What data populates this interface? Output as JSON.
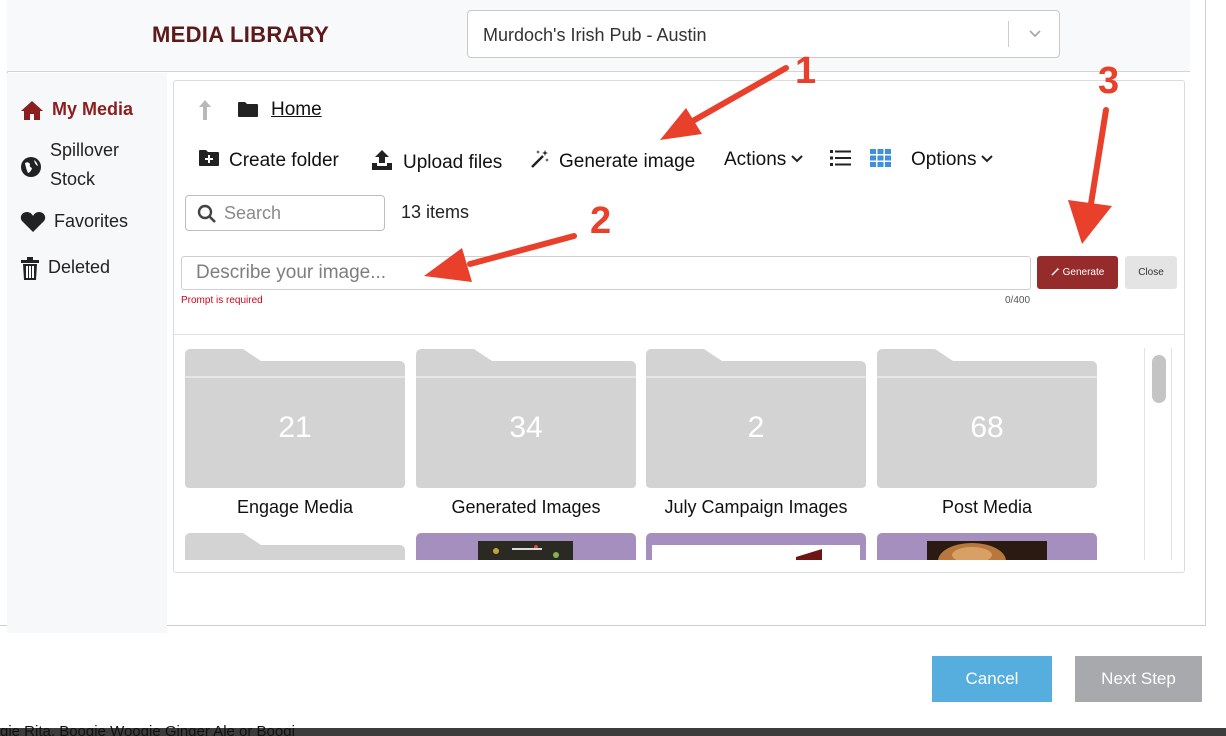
{
  "header": {
    "title": "MEDIA LIBRARY",
    "location_select": {
      "value": "Murdoch's Irish Pub - Austin"
    }
  },
  "sidebar": {
    "items": [
      {
        "label": "My Media",
        "icon": "home-icon",
        "active": true
      },
      {
        "label": "Spillover Stock",
        "icon": "globe-icon",
        "active": false
      },
      {
        "label": "Favorites",
        "icon": "heart-icon",
        "active": false
      },
      {
        "label": "Deleted",
        "icon": "trash-icon",
        "active": false
      }
    ]
  },
  "breadcrumb": {
    "home": "Home"
  },
  "toolbar": {
    "create_folder": "Create folder",
    "upload_files": "Upload files",
    "generate_image": "Generate image",
    "actions": "Actions",
    "options": "Options"
  },
  "search": {
    "placeholder": "Search",
    "item_count": "13 items"
  },
  "generate_panel": {
    "placeholder": "Describe your image...",
    "error": "Prompt is required",
    "char_count": "0/400",
    "generate_label": "Generate",
    "close_label": "Close"
  },
  "folders": [
    {
      "name": "Engage Media",
      "count": "21"
    },
    {
      "name": "Generated Images",
      "count": "34"
    },
    {
      "name": "July Campaign Images",
      "count": "2"
    },
    {
      "name": "Post Media",
      "count": "68"
    }
  ],
  "footer": {
    "cancel": "Cancel",
    "next": "Next Step"
  },
  "background_text": "gie Rita, Boogie Woogie Ginger Ale or Boogi",
  "annotations": [
    "1",
    "2",
    "3"
  ],
  "colors": {
    "brand": "#5c1a1a",
    "active": "#8b1e1e",
    "generate_button": "#962b2b",
    "cancel_button": "#55aedd",
    "next_button": "#a7a9ac",
    "annotation": "#e8402a",
    "grid_icon": "#3d8fe0",
    "thumbnail": "#a48fbf"
  }
}
